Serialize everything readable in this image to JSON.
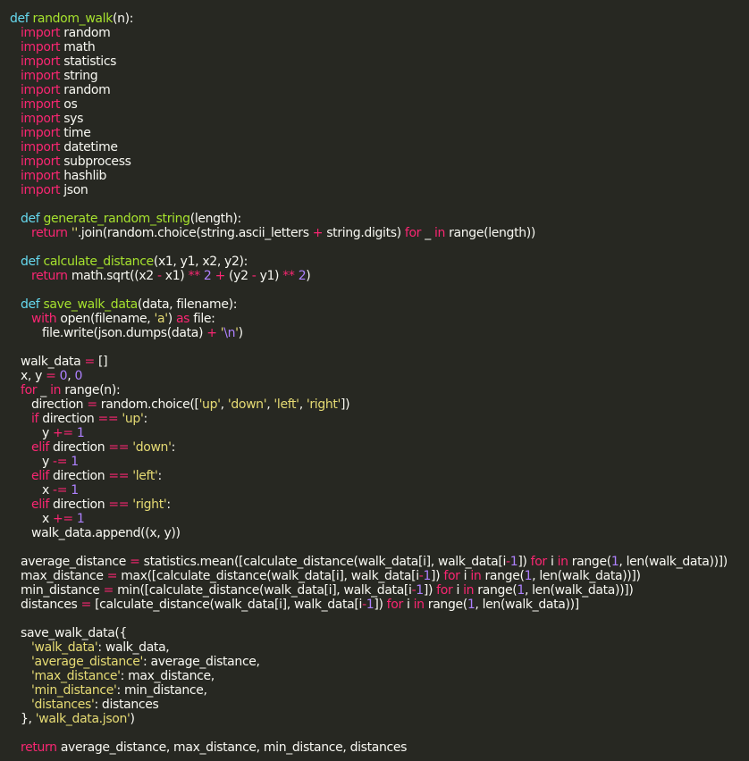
{
  "editor": {
    "lines": [
      {
        "indent": 0,
        "tokens": [
          [
            "def",
            "def "
          ],
          [
            "fn",
            "random_walk"
          ],
          [
            "t",
            "(n):"
          ]
        ]
      },
      {
        "indent": 1,
        "tokens": [
          [
            "kw",
            "import"
          ],
          [
            "t",
            " random"
          ]
        ]
      },
      {
        "indent": 1,
        "tokens": [
          [
            "kw",
            "import"
          ],
          [
            "t",
            " math"
          ]
        ]
      },
      {
        "indent": 1,
        "tokens": [
          [
            "kw",
            "import"
          ],
          [
            "t",
            " statistics"
          ]
        ]
      },
      {
        "indent": 1,
        "tokens": [
          [
            "kw",
            "import"
          ],
          [
            "t",
            " string"
          ]
        ]
      },
      {
        "indent": 1,
        "tokens": [
          [
            "kw",
            "import"
          ],
          [
            "t",
            " random"
          ]
        ]
      },
      {
        "indent": 1,
        "tokens": [
          [
            "kw",
            "import"
          ],
          [
            "t",
            " os"
          ]
        ]
      },
      {
        "indent": 1,
        "tokens": [
          [
            "kw",
            "import"
          ],
          [
            "t",
            " sys"
          ]
        ]
      },
      {
        "indent": 1,
        "tokens": [
          [
            "kw",
            "import"
          ],
          [
            "t",
            " time"
          ]
        ]
      },
      {
        "indent": 1,
        "tokens": [
          [
            "kw",
            "import"
          ],
          [
            "t",
            " datetime"
          ]
        ]
      },
      {
        "indent": 1,
        "tokens": [
          [
            "kw",
            "import"
          ],
          [
            "t",
            " subprocess"
          ]
        ]
      },
      {
        "indent": 1,
        "tokens": [
          [
            "kw",
            "import"
          ],
          [
            "t",
            " hashlib"
          ]
        ]
      },
      {
        "indent": 1,
        "tokens": [
          [
            "kw",
            "import"
          ],
          [
            "t",
            " json"
          ]
        ]
      },
      {
        "indent": 0,
        "tokens": []
      },
      {
        "indent": 1,
        "tokens": [
          [
            "def",
            "def "
          ],
          [
            "fn",
            "generate_random_string"
          ],
          [
            "t",
            "(length):"
          ]
        ]
      },
      {
        "indent": 2,
        "tokens": [
          [
            "kw",
            "return"
          ],
          [
            "t",
            " "
          ],
          [
            "str",
            "''"
          ],
          [
            "t",
            ".join(random.choice(string.ascii_letters "
          ],
          [
            "op",
            "+"
          ],
          [
            "t",
            " string.digits) "
          ],
          [
            "kw",
            "for"
          ],
          [
            "t",
            " _ "
          ],
          [
            "kw",
            "in"
          ],
          [
            "t",
            " range(length))"
          ]
        ]
      },
      {
        "indent": 0,
        "tokens": []
      },
      {
        "indent": 1,
        "tokens": [
          [
            "def",
            "def "
          ],
          [
            "fn",
            "calculate_distance"
          ],
          [
            "t",
            "(x1, y1, x2, y2):"
          ]
        ]
      },
      {
        "indent": 2,
        "tokens": [
          [
            "kw",
            "return"
          ],
          [
            "t",
            " math.sqrt((x2 "
          ],
          [
            "op",
            "-"
          ],
          [
            "t",
            " x1) "
          ],
          [
            "op",
            "**"
          ],
          [
            "t",
            " "
          ],
          [
            "num",
            "2"
          ],
          [
            "t",
            " "
          ],
          [
            "op",
            "+"
          ],
          [
            "t",
            " (y2 "
          ],
          [
            "op",
            "-"
          ],
          [
            "t",
            " y1) "
          ],
          [
            "op",
            "**"
          ],
          [
            "t",
            " "
          ],
          [
            "num",
            "2"
          ],
          [
            "t",
            ")"
          ]
        ]
      },
      {
        "indent": 0,
        "tokens": []
      },
      {
        "indent": 1,
        "tokens": [
          [
            "def",
            "def "
          ],
          [
            "fn",
            "save_walk_data"
          ],
          [
            "t",
            "(data, filename):"
          ]
        ]
      },
      {
        "indent": 2,
        "tokens": [
          [
            "kw",
            "with"
          ],
          [
            "t",
            " open(filename, "
          ],
          [
            "str",
            "'a'"
          ],
          [
            "t",
            ") "
          ],
          [
            "kw",
            "as"
          ],
          [
            "t",
            " file:"
          ]
        ]
      },
      {
        "indent": 3,
        "tokens": [
          [
            "t",
            "file.write(json.dumps(data) "
          ],
          [
            "op",
            "+"
          ],
          [
            "t",
            " "
          ],
          [
            "str",
            "'"
          ],
          [
            "esc",
            "\\n"
          ],
          [
            "str",
            "'"
          ],
          [
            "t",
            ")"
          ]
        ]
      },
      {
        "indent": 0,
        "tokens": []
      },
      {
        "indent": 1,
        "tokens": [
          [
            "t",
            "walk_data "
          ],
          [
            "op",
            "="
          ],
          [
            "t",
            " []"
          ]
        ]
      },
      {
        "indent": 1,
        "tokens": [
          [
            "t",
            "x, y "
          ],
          [
            "op",
            "="
          ],
          [
            "t",
            " "
          ],
          [
            "num",
            "0"
          ],
          [
            "t",
            ", "
          ],
          [
            "num",
            "0"
          ]
        ]
      },
      {
        "indent": 1,
        "tokens": [
          [
            "kw",
            "for"
          ],
          [
            "t",
            " _ "
          ],
          [
            "kw",
            "in"
          ],
          [
            "t",
            " range(n):"
          ]
        ]
      },
      {
        "indent": 2,
        "tokens": [
          [
            "t",
            "direction "
          ],
          [
            "op",
            "="
          ],
          [
            "t",
            " random.choice(["
          ],
          [
            "str",
            "'up'"
          ],
          [
            "t",
            ", "
          ],
          [
            "str",
            "'down'"
          ],
          [
            "t",
            ", "
          ],
          [
            "str",
            "'left'"
          ],
          [
            "t",
            ", "
          ],
          [
            "str",
            "'right'"
          ],
          [
            "t",
            "])"
          ]
        ]
      },
      {
        "indent": 2,
        "tokens": [
          [
            "kw",
            "if"
          ],
          [
            "t",
            " direction "
          ],
          [
            "op",
            "=="
          ],
          [
            "t",
            " "
          ],
          [
            "str",
            "'up'"
          ],
          [
            "t",
            ":"
          ]
        ]
      },
      {
        "indent": 3,
        "tokens": [
          [
            "t",
            "y "
          ],
          [
            "op",
            "+="
          ],
          [
            "t",
            " "
          ],
          [
            "num",
            "1"
          ]
        ]
      },
      {
        "indent": 2,
        "tokens": [
          [
            "kw",
            "elif"
          ],
          [
            "t",
            " direction "
          ],
          [
            "op",
            "=="
          ],
          [
            "t",
            " "
          ],
          [
            "str",
            "'down'"
          ],
          [
            "t",
            ":"
          ]
        ]
      },
      {
        "indent": 3,
        "tokens": [
          [
            "t",
            "y "
          ],
          [
            "op",
            "-="
          ],
          [
            "t",
            " "
          ],
          [
            "num",
            "1"
          ]
        ]
      },
      {
        "indent": 2,
        "tokens": [
          [
            "kw",
            "elif"
          ],
          [
            "t",
            " direction "
          ],
          [
            "op",
            "=="
          ],
          [
            "t",
            " "
          ],
          [
            "str",
            "'left'"
          ],
          [
            "t",
            ":"
          ]
        ]
      },
      {
        "indent": 3,
        "tokens": [
          [
            "t",
            "x "
          ],
          [
            "op",
            "-="
          ],
          [
            "t",
            " "
          ],
          [
            "num",
            "1"
          ]
        ]
      },
      {
        "indent": 2,
        "tokens": [
          [
            "kw",
            "elif"
          ],
          [
            "t",
            " direction "
          ],
          [
            "op",
            "=="
          ],
          [
            "t",
            " "
          ],
          [
            "str",
            "'right'"
          ],
          [
            "t",
            ":"
          ]
        ]
      },
      {
        "indent": 3,
        "tokens": [
          [
            "t",
            "x "
          ],
          [
            "op",
            "+="
          ],
          [
            "t",
            " "
          ],
          [
            "num",
            "1"
          ]
        ]
      },
      {
        "indent": 2,
        "tokens": [
          [
            "t",
            "walk_data.append((x, y))"
          ]
        ]
      },
      {
        "indent": 0,
        "tokens": []
      },
      {
        "indent": 1,
        "tokens": [
          [
            "t",
            "average_distance "
          ],
          [
            "op",
            "="
          ],
          [
            "t",
            " statistics.mean([calculate_distance(walk_data[i], walk_data[i"
          ],
          [
            "op",
            "-"
          ],
          [
            "num",
            "1"
          ],
          [
            "t",
            "]) "
          ],
          [
            "kw",
            "for"
          ],
          [
            "t",
            " i "
          ],
          [
            "kw",
            "in"
          ],
          [
            "t",
            " range("
          ],
          [
            "num",
            "1"
          ],
          [
            "t",
            ", len(walk_data))])"
          ]
        ]
      },
      {
        "indent": 1,
        "tokens": [
          [
            "t",
            "max_distance "
          ],
          [
            "op",
            "="
          ],
          [
            "t",
            " max([calculate_distance(walk_data[i], walk_data[i"
          ],
          [
            "op",
            "-"
          ],
          [
            "num",
            "1"
          ],
          [
            "t",
            "]) "
          ],
          [
            "kw",
            "for"
          ],
          [
            "t",
            " i "
          ],
          [
            "kw",
            "in"
          ],
          [
            "t",
            " range("
          ],
          [
            "num",
            "1"
          ],
          [
            "t",
            ", len(walk_data))])"
          ]
        ]
      },
      {
        "indent": 1,
        "tokens": [
          [
            "t",
            "min_distance "
          ],
          [
            "op",
            "="
          ],
          [
            "t",
            " min([calculate_distance(walk_data[i], walk_data[i"
          ],
          [
            "op",
            "-"
          ],
          [
            "num",
            "1"
          ],
          [
            "t",
            "]) "
          ],
          [
            "kw",
            "for"
          ],
          [
            "t",
            " i "
          ],
          [
            "kw",
            "in"
          ],
          [
            "t",
            " range("
          ],
          [
            "num",
            "1"
          ],
          [
            "t",
            ", len(walk_data))])"
          ]
        ]
      },
      {
        "indent": 1,
        "tokens": [
          [
            "t",
            "distances "
          ],
          [
            "op",
            "="
          ],
          [
            "t",
            " [calculate_distance(walk_data[i], walk_data[i"
          ],
          [
            "op",
            "-"
          ],
          [
            "num",
            "1"
          ],
          [
            "t",
            "]) "
          ],
          [
            "kw",
            "for"
          ],
          [
            "t",
            " i "
          ],
          [
            "kw",
            "in"
          ],
          [
            "t",
            " range("
          ],
          [
            "num",
            "1"
          ],
          [
            "t",
            ", len(walk_data))]"
          ]
        ]
      },
      {
        "indent": 0,
        "tokens": []
      },
      {
        "indent": 1,
        "tokens": [
          [
            "t",
            "save_walk_data({"
          ]
        ]
      },
      {
        "indent": 2,
        "tokens": [
          [
            "str",
            "'walk_data'"
          ],
          [
            "t",
            ": walk_data,"
          ]
        ]
      },
      {
        "indent": 2,
        "tokens": [
          [
            "str",
            "'average_distance'"
          ],
          [
            "t",
            ": average_distance,"
          ]
        ]
      },
      {
        "indent": 2,
        "tokens": [
          [
            "str",
            "'max_distance'"
          ],
          [
            "t",
            ": max_distance,"
          ]
        ]
      },
      {
        "indent": 2,
        "tokens": [
          [
            "str",
            "'min_distance'"
          ],
          [
            "t",
            ": min_distance,"
          ]
        ]
      },
      {
        "indent": 2,
        "tokens": [
          [
            "str",
            "'distances'"
          ],
          [
            "t",
            ": distances"
          ]
        ]
      },
      {
        "indent": 1,
        "tokens": [
          [
            "t",
            "}, "
          ],
          [
            "str",
            "'walk_data.json'"
          ],
          [
            "t",
            ")"
          ]
        ]
      },
      {
        "indent": 0,
        "tokens": []
      },
      {
        "indent": 1,
        "tokens": [
          [
            "kw",
            "return"
          ],
          [
            "t",
            " average_distance, max_distance, min_distance, distances"
          ]
        ]
      }
    ]
  },
  "colors": {
    "background": "#272822",
    "text": "#f8f8f2",
    "keyword": "#f92672",
    "def_keyword": "#66d9ef",
    "function_name": "#a6e22e",
    "string": "#e6db74",
    "number": "#ae81ff"
  }
}
